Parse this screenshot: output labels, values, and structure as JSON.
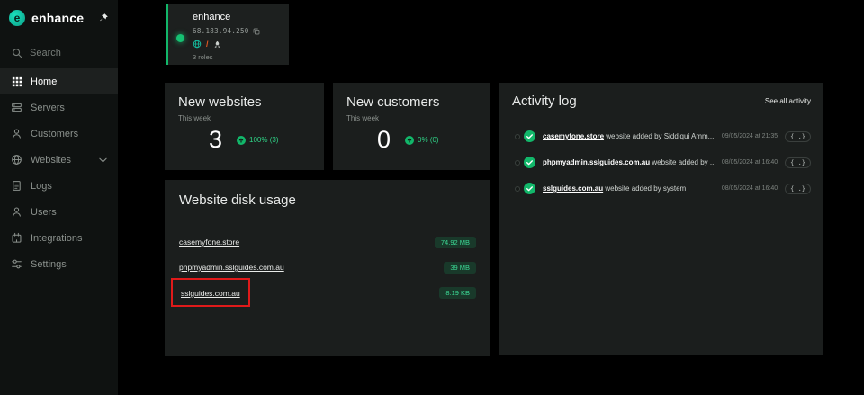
{
  "colors": {
    "accent_green": "#12b76a",
    "teal": "#14c3a5",
    "annotation_red": "#e01a1a"
  },
  "sidebar": {
    "logo_glyph": "e",
    "logo_text": "enhance",
    "search_label": "Search",
    "items": [
      {
        "label": "Home"
      },
      {
        "label": "Servers"
      },
      {
        "label": "Customers"
      },
      {
        "label": "Websites"
      },
      {
        "label": "Logs"
      },
      {
        "label": "Users"
      },
      {
        "label": "Integrations"
      },
      {
        "label": "Settings"
      }
    ]
  },
  "server_card": {
    "name": "enhance",
    "ip": "68.183.94.250",
    "roles": "3 roles"
  },
  "stats": [
    {
      "title": "New websites",
      "subtitle": "This week",
      "value": "3",
      "badge": "100% (3)"
    },
    {
      "title": "New customers",
      "subtitle": "This week",
      "value": "0",
      "badge": "0% (0)"
    }
  ],
  "disk_usage": {
    "title": "Website disk usage",
    "rows": [
      {
        "site": "casemyfone.store",
        "size": "74.92 MB"
      },
      {
        "site": "phpmyadmin.sslguides.com.au",
        "size": "39 MB"
      },
      {
        "site": "sslguides.com.au",
        "size": "8.19 KB"
      }
    ]
  },
  "activity": {
    "title": "Activity log",
    "see_all": "See all activity",
    "items": [
      {
        "link": "casemyfone.store",
        "rest": "website added by Siddiqui Amm...",
        "date": "09/05/2024 at 21:35",
        "badge": "{..}"
      },
      {
        "link": "phpmyadmin.sslguides.com.au",
        "rest": "website added by ...",
        "date": "08/05/2024 at 16:40",
        "badge": "{..}"
      },
      {
        "link": "sslguides.com.au",
        "rest": "website added by system",
        "date": "08/05/2024 at 16:40",
        "badge": "{..}"
      }
    ]
  }
}
